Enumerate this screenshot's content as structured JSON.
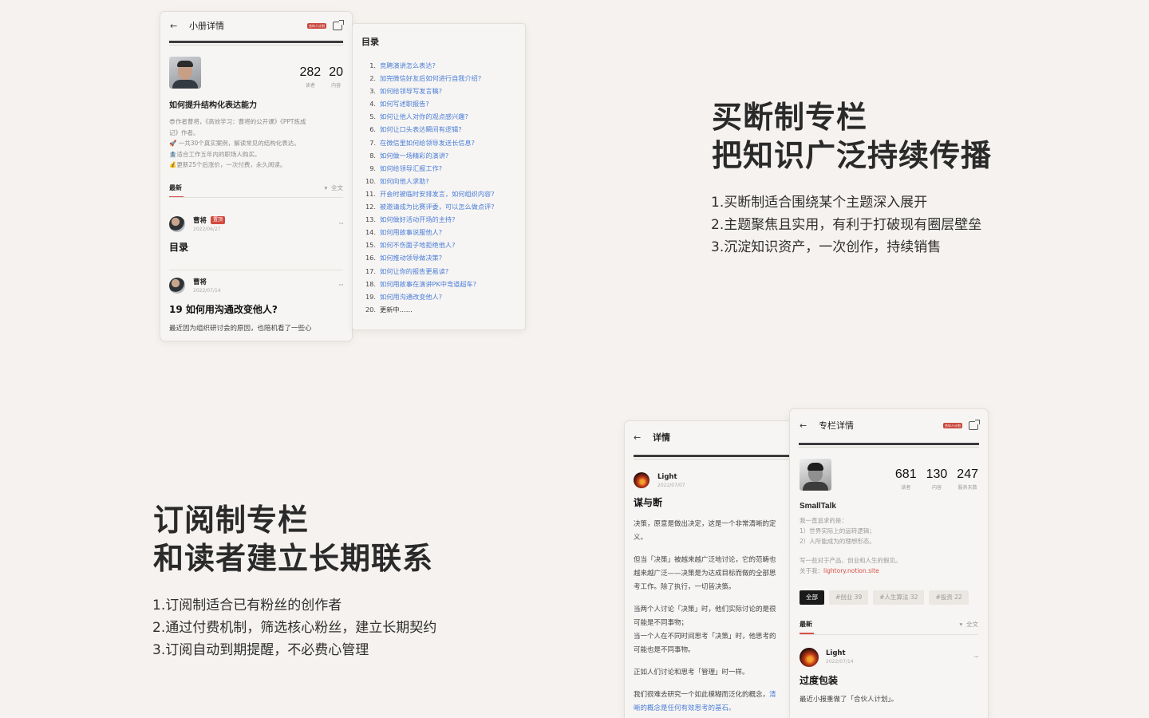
{
  "booklet_card": {
    "header_title": "小册详情",
    "badge": "合伙人计划",
    "stats": [
      {
        "value": "282",
        "label": "读者"
      },
      {
        "value": "20",
        "label": "内容"
      }
    ],
    "title": "如何提升结构化表达能力",
    "desc_lines": [
      "😎作者曹将，《高效学习：曹将的公开课》《PPT炼成",
      "记》作者。",
      "🚀 一共30个真实案例，解读常见的结构化表达。",
      "🏦适合工作五年内的职场人购买。",
      "💰更新25个后涨价，一次付费，永久阅读。"
    ],
    "latest_label": "最新",
    "sort_label": "全文",
    "posts": [
      {
        "author": "曹将",
        "pin": "置顶",
        "date": "2022/06/27",
        "title": "目录"
      },
      {
        "author": "曹将",
        "date": "2022/07/14",
        "title": "19 如何用沟通改变他人?",
        "excerpt": "最近因为组织研讨会的原因，也陪机看了一些心"
      }
    ]
  },
  "toc_card": {
    "title": "目录",
    "items": [
      "竞聘演讲怎么表达?",
      "加完微信好友后如何进行自我介绍?",
      "如何给领导写发言稿?",
      "如何写述职报告?",
      "如何让他人对你的观点感兴趣?",
      "如何让口头表达瞬间有逻辑?",
      "在微信里如何给领导发送长信息?",
      "如何做一场精彩的演讲?",
      "如何给领导汇报工作?",
      "如何向他人求助?",
      "开会时被临时安排发言，如何组织内容?",
      "被邀请成为比赛评委，可以怎么做点评?",
      "如何做好活动开场的主持?",
      "如何用故事说服他人?",
      "如何不伤面子地拒绝他人?",
      "如何推动领导做决策?",
      "如何让你的报告更易读?",
      "如何用故事在演讲PK中弯道超车?",
      "如何用沟通改变他人?",
      "更新中……"
    ]
  },
  "buyout_section": {
    "title_line1": "买断制专栏",
    "title_line2": "把知识广泛持续传播",
    "points": [
      "1.买断制适合围绕某个主题深入展开",
      "2.主题聚焦且实用，有利于打破现有圈层壁垒",
      "3.沉淀知识资产，一次创作，持续销售"
    ]
  },
  "subscription_section": {
    "title_line1": "订阅制专栏",
    "title_line2": "和读者建立长期联系",
    "points": [
      "1.订阅制适合已有粉丝的创作者",
      "2.通过付费机制，筛选核心粉丝，建立长期契约",
      "3.订阅自动到期提醒，不必费心管理"
    ]
  },
  "article_card": {
    "header_title": "详情",
    "author": "Light",
    "date": "2022/07/07",
    "title": "谋与断",
    "paragraphs": [
      [
        "决策，原意是做出决定，这是一个非常清晰的定",
        "义。"
      ],
      [
        "但当「决策」被越来越广泛地讨论，它的范畴也",
        "越来越广泛——决策是为达成目标而做的全部思",
        "考工作。除了执行，一切皆决策。"
      ],
      [
        "当两个人讨论「决策」时，他们实际讨论的是很",
        "可能是不同事物；",
        "当一个人在不同时间思考「决策」时，他思考的",
        "可能也是不同事物。"
      ],
      [
        "正如人们讨论和思考「管理」时一样。"
      ]
    ],
    "last_para_plain": "我们很难去研究一个如此模糊而泛化的概念，",
    "last_para_link1": "清",
    "last_para_link2": "晰的概念是任何有效思考的基石。",
    "last_para_end": ""
  },
  "column_card": {
    "header_title": "专栏详情",
    "badge": "合伙人计划",
    "stats": [
      {
        "value": "681",
        "label": "读者"
      },
      {
        "value": "130",
        "label": "内容"
      },
      {
        "value": "247",
        "label": "服务天数"
      }
    ],
    "title": "SmallTalk",
    "desc_lines": [
      "我一直追求的是：",
      "1）世界实际上的运转逻辑；",
      "2）人所能成为的理想形态。"
    ],
    "desc2": "写一些对于产品、创业和人生的假见。",
    "about_label": "关于我：",
    "about_link": "lightory.notion.site",
    "tags": [
      "全部",
      "#创业 39",
      "#人生算法 32",
      "#投资 22"
    ],
    "latest_label": "最新",
    "sort_label": "全文",
    "post": {
      "author": "Light",
      "date": "2022/07/14",
      "title": "过度包装",
      "excerpt": "最近小报重做了「合伙人计划」。"
    }
  }
}
